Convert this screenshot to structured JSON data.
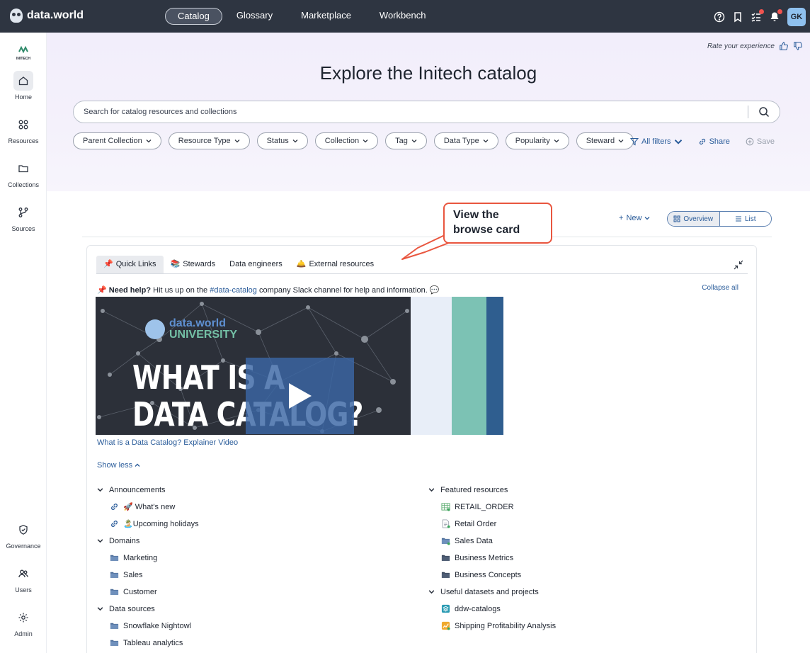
{
  "app": {
    "logo_text": "data.world"
  },
  "nav": {
    "items": [
      "Catalog",
      "Glossary",
      "Marketplace",
      "Workbench"
    ],
    "active": "Catalog"
  },
  "user": {
    "initials": "GK"
  },
  "rail": {
    "org": "INITECH",
    "items": [
      {
        "label": "Home",
        "icon": "home-icon"
      },
      {
        "label": "Resources",
        "icon": "resources-icon"
      },
      {
        "label": "Collections",
        "icon": "folder-icon"
      },
      {
        "label": "Sources",
        "icon": "sources-icon"
      }
    ],
    "bottom_items": [
      {
        "label": "Governance",
        "icon": "shield-icon"
      },
      {
        "label": "Users",
        "icon": "users-icon"
      },
      {
        "label": "Admin",
        "icon": "gear-icon"
      }
    ]
  },
  "hero": {
    "rate_label": "Rate your experience",
    "title": "Explore the Initech catalog",
    "search_placeholder": "Search for catalog resources and collections",
    "filters": [
      "Parent Collection",
      "Resource Type",
      "Status",
      "Collection",
      "Tag",
      "Data Type",
      "Popularity",
      "Steward"
    ],
    "all_filters": "All filters",
    "share": "Share",
    "save": "Save"
  },
  "toolbar": {
    "new_label": "New",
    "overview_label": "Overview",
    "list_label": "List"
  },
  "callout": {
    "line1": "View the",
    "line2": "browse card"
  },
  "card": {
    "tabs": [
      {
        "emoji": "📌",
        "label": "Quick Links"
      },
      {
        "emoji": "📚",
        "label": "Stewards"
      },
      {
        "emoji": "",
        "label": "Data engineers"
      },
      {
        "emoji": "🛎️",
        "label": "External resources"
      }
    ],
    "help_bold": "Need help?",
    "help_text1": "Hit us up on the",
    "help_link": "#data-catalog",
    "help_text2": "company Slack channel for help and information.",
    "collapse_all": "Collapse all",
    "video": {
      "brand_line1": "data.world",
      "brand_line2": "UNIVERSITY",
      "headline_line1": "WHAT IS A",
      "headline_line2": "DATA CATALOG?",
      "caption": "What is a Data Catalog? Explainer Video"
    },
    "show_less": "Show less",
    "left_groups": [
      {
        "title": "Announcements",
        "items": [
          {
            "label": "🚀 What's new",
            "icon": "link-icon"
          },
          {
            "label": "🏝️Upcoming holidays",
            "icon": "link-icon"
          }
        ]
      },
      {
        "title": "Domains",
        "items": [
          {
            "label": "Marketing",
            "icon": "folder-icon"
          },
          {
            "label": "Sales",
            "icon": "folder-icon"
          },
          {
            "label": "Customer",
            "icon": "folder-icon"
          }
        ]
      },
      {
        "title": "Data sources",
        "items": [
          {
            "label": "Snowflake Nightowl",
            "icon": "folder-icon"
          },
          {
            "label": "Tableau analytics",
            "icon": "folder-icon"
          }
        ]
      }
    ],
    "right_groups": [
      {
        "title": "Featured resources",
        "items": [
          {
            "label": "RETAIL_ORDER",
            "icon": "table-icon"
          },
          {
            "label": "Retail Order",
            "icon": "document-icon"
          },
          {
            "label": "Sales Data",
            "icon": "folder-icon"
          },
          {
            "label": "Business Metrics",
            "icon": "folder-icon"
          },
          {
            "label": "Business Concepts",
            "icon": "folder-icon"
          }
        ]
      },
      {
        "title": "Useful datasets and projects",
        "items": [
          {
            "label": "ddw-catalogs",
            "icon": "dataset-icon"
          },
          {
            "label": "Shipping Profitability Analysis",
            "icon": "project-icon"
          }
        ]
      }
    ]
  },
  "colors": {
    "topbar": "#2e3541",
    "link": "#2a5c9a",
    "callout_border": "#e9563f",
    "avatar": "#8fc1ef"
  }
}
